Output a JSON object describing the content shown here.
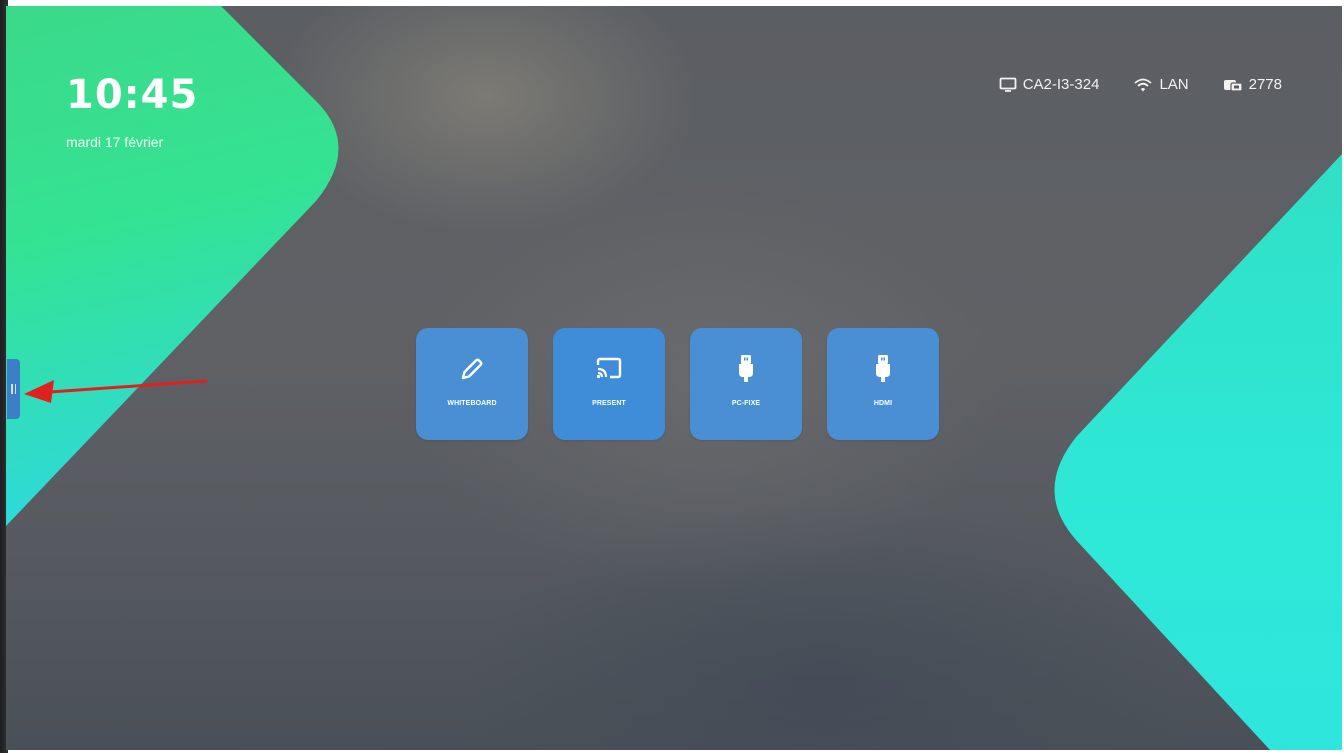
{
  "clock": {
    "time": "10:45",
    "date": "mardi 17 février"
  },
  "status": {
    "device": {
      "icon": "monitor-icon",
      "label": "CA2-I3-324"
    },
    "network": {
      "icon": "wifi-icon",
      "label": "LAN"
    },
    "code": {
      "icon": "cast-code-icon",
      "label": "2778"
    }
  },
  "tiles": [
    {
      "label": "WHITEBOARD",
      "icon": "pencil-icon"
    },
    {
      "label": "PRESENT",
      "icon": "screen-cast-icon"
    },
    {
      "label": "PC-FIXE",
      "icon": "hdmi-plug-icon"
    },
    {
      "label": "HDMI",
      "icon": "hdmi-plug-icon"
    }
  ],
  "side_handle": {
    "icon": "drag-handle-icon"
  },
  "annotation": {
    "icon": "red-arrow-icon",
    "color": "#e0201e"
  },
  "colors": {
    "tile": "#4a8fd3",
    "accent_green": "#3ee88a",
    "accent_cyan": "#2ee6d6",
    "background": "#5b5e63"
  }
}
